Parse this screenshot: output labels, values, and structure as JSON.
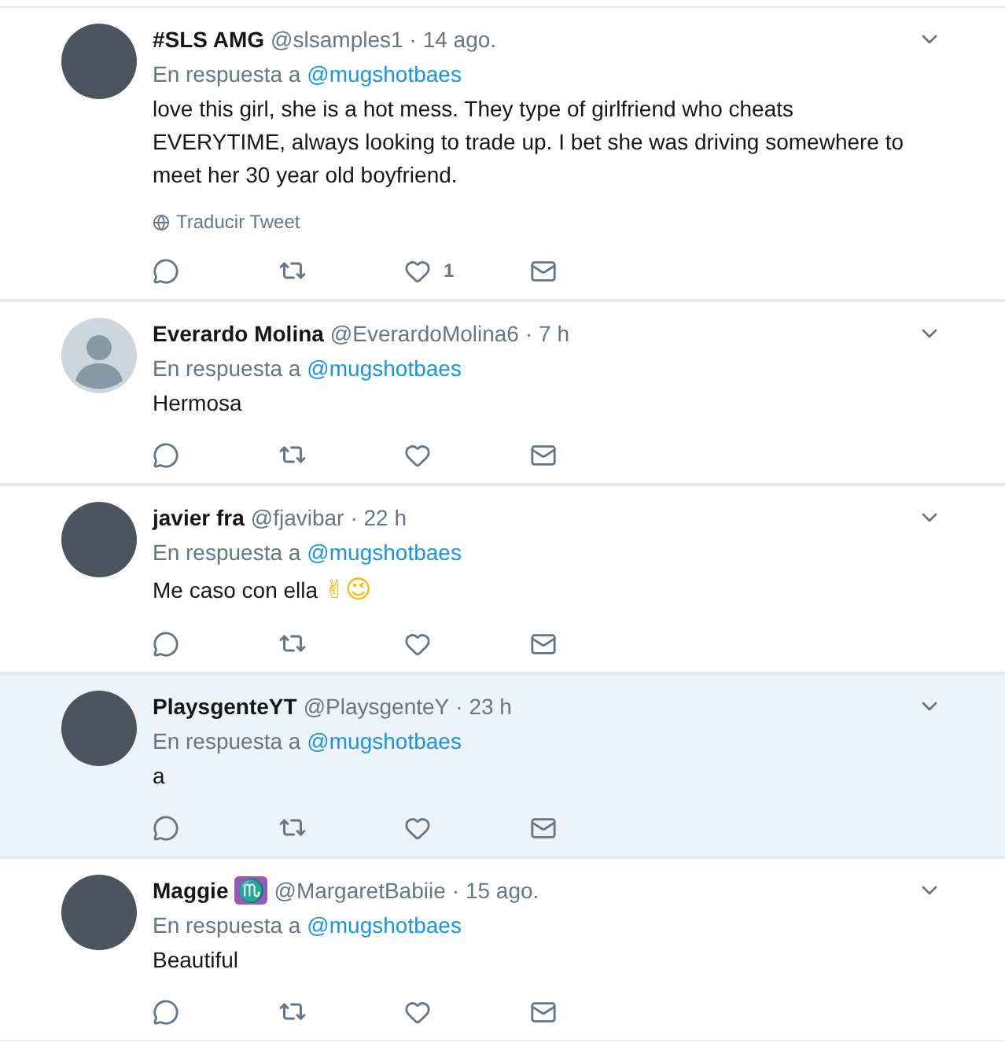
{
  "tweets": [
    {
      "avatar": {
        "kind": "photo"
      },
      "name": "#SLS AMG",
      "handle": "@slsamples1",
      "time": "· 14 ago.",
      "reply_prefix": "En respuesta a",
      "reply_to": "@mugshotbaes",
      "text": "love this girl, she is a hot mess.  They type of girlfriend who cheats EVERYTIME, always looking to trade up.  I bet she was driving somewhere to meet her 30 year old boyfriend.",
      "translate": "Traducir Tweet",
      "likes": "1",
      "highlighted": false
    },
    {
      "avatar": {
        "kind": "silhouette"
      },
      "name": "Everardo Molina",
      "handle": "@EverardoMolina6",
      "time": "· 7 h",
      "reply_prefix": "En respuesta a",
      "reply_to": "@mugshotbaes",
      "text": "Hermosa",
      "highlighted": false
    },
    {
      "avatar": {
        "kind": "photo"
      },
      "name": "javier fra",
      "handle": "@fjavibar",
      "time": "· 22 h",
      "reply_prefix": "En respuesta a",
      "reply_to": "@mugshotbaes",
      "text": "Me caso con ella",
      "emoji": "✌😉",
      "highlighted": false
    },
    {
      "avatar": {
        "kind": "photo"
      },
      "name": "PlaysgenteYT",
      "handle": "@PlaysgenteY",
      "time": "· 23 h",
      "reply_prefix": "En respuesta a",
      "reply_to": "@mugshotbaes",
      "text": "a",
      "highlighted": true
    },
    {
      "avatar": {
        "kind": "photo"
      },
      "name": "Maggie",
      "badge": "♏",
      "handle": "@MargaretBabiie",
      "time": "· 15 ago.",
      "reply_prefix": "En respuesta a",
      "reply_to": "@mugshotbaes",
      "text": "Beautiful",
      "highlighted": false
    }
  ]
}
